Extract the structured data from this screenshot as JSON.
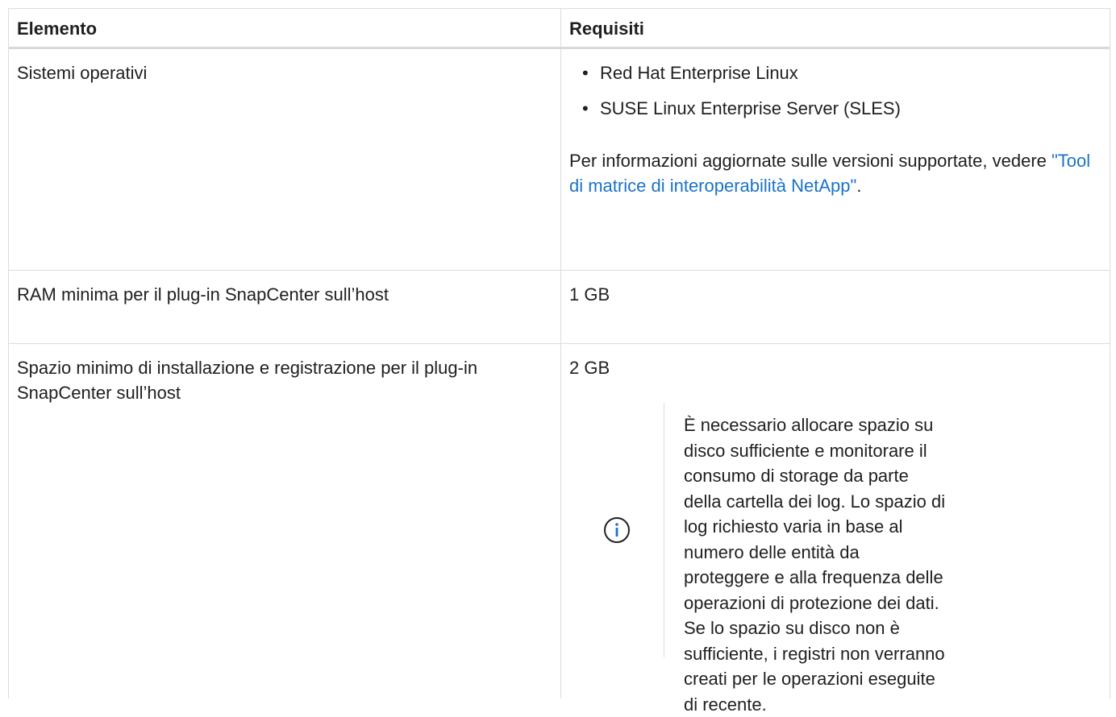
{
  "table": {
    "header": {
      "col1": "Elemento",
      "col2": "Requisiti"
    },
    "rows": {
      "os": {
        "label": "Sistemi operativi",
        "items": [
          "Red Hat Enterprise Linux",
          "SUSE Linux Enterprise Server (SLES)"
        ],
        "bullet": "•",
        "support_prefix": "Per informazioni aggiornate sulle versioni supportate, vedere ",
        "support_link": "\"Tool di matrice di interoperabilità NetApp\"",
        "support_suffix": "."
      },
      "ram": {
        "label": "RAM minima per il plug-in SnapCenter sull’host",
        "value": "1 GB"
      },
      "space": {
        "label": "Spazio minimo di installazione e registrazione per il plug-in SnapCenter sull’host",
        "value": "2 GB",
        "note_icon": "info-circle-icon",
        "note": "È necessario allocare spazio su disco sufficiente e monitorare il consumo di storage da parte della cartella dei log. Lo spazio di log richiesto varia in base al numero delle entità da proteggere e alla frequenza delle operazioni di protezione dei dati. Se lo spazio su disco non è sufficiente, i registri non verranno creati per le operazioni eseguite di recente."
      }
    }
  },
  "colors": {
    "link": "#1a73c8",
    "icon": "#1a73c8",
    "border": "#dcdcdc"
  }
}
